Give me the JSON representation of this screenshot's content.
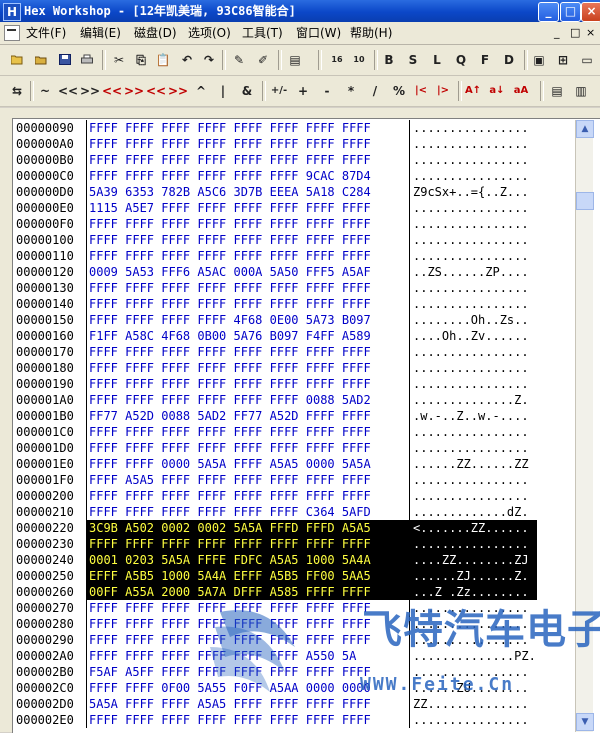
{
  "window": {
    "title": "Hex Workshop - [12年凯美瑞, 93C86智能合]",
    "minimize": "_",
    "maximize": "□",
    "close": "×"
  },
  "menu": {
    "items": [
      "文件(F)",
      "编辑(E)",
      "磁盘(D)",
      "选项(O)",
      "工具(T)",
      "窗口(W)",
      "帮助(H)"
    ],
    "mdi_min": "_",
    "mdi_max": "□",
    "mdi_close": "×"
  },
  "toolbar1": {
    "text_buttons": [
      "B",
      "S",
      "L",
      "Q",
      "F",
      "D"
    ],
    "mode_16": "16",
    "mode_10": "10"
  },
  "toolbar2": {
    "buttons": [
      "⇆",
      "~",
      "<<",
      ">>",
      "<<",
      ">>",
      "<<",
      ">>",
      "^",
      "|",
      "&",
      "+/-",
      "+",
      "-",
      "*",
      "/",
      "%",
      "|<",
      "|>",
      "A↑",
      "a↓",
      "aA"
    ]
  },
  "hex": {
    "rows": [
      {
        "addr": "00000090",
        "hex": "FFFF FFFF FFFF FFFF FFFF FFFF FFFF FFFF",
        "ascii": "................"
      },
      {
        "addr": "000000A0",
        "hex": "FFFF FFFF FFFF FFFF FFFF FFFF FFFF FFFF",
        "ascii": "................"
      },
      {
        "addr": "000000B0",
        "hex": "FFFF FFFF FFFF FFFF FFFF FFFF FFFF FFFF",
        "ascii": "................"
      },
      {
        "addr": "000000C0",
        "hex": "FFFF FFFF FFFF FFFF FFFF FFFF 9CAC 87D4",
        "ascii": "................"
      },
      {
        "addr": "000000D0",
        "hex": "5A39 6353 782B A5C6 3D7B EEEA 5A18 C284",
        "ascii": "Z9cSx+..={..Z..."
      },
      {
        "addr": "000000E0",
        "hex": "1115 A5E7 FFFF FFFF FFFF FFFF FFFF FFFF",
        "ascii": "................"
      },
      {
        "addr": "000000F0",
        "hex": "FFFF FFFF FFFF FFFF FFFF FFFF FFFF FFFF",
        "ascii": "................"
      },
      {
        "addr": "00000100",
        "hex": "FFFF FFFF FFFF FFFF FFFF FFFF FFFF FFFF",
        "ascii": "................"
      },
      {
        "addr": "00000110",
        "hex": "FFFF FFFF FFFF FFFF FFFF FFFF FFFF FFFF",
        "ascii": "................"
      },
      {
        "addr": "00000120",
        "hex": "0009 5A53 FFF6 A5AC 000A 5A50 FFF5 A5AF",
        "ascii": "..ZS......ZP...."
      },
      {
        "addr": "00000130",
        "hex": "FFFF FFFF FFFF FFFF FFFF FFFF FFFF FFFF",
        "ascii": "................"
      },
      {
        "addr": "00000140",
        "hex": "FFFF FFFF FFFF FFFF FFFF FFFF FFFF FFFF",
        "ascii": "................"
      },
      {
        "addr": "00000150",
        "hex": "FFFF FFFF FFFF FFFF 4F68 0E00 5A73 B097",
        "ascii": "........Oh..Zs.."
      },
      {
        "addr": "00000160",
        "hex": "F1FF A58C 4F68 0B00 5A76 B097 F4FF A589",
        "ascii": "....Oh..Zv......"
      },
      {
        "addr": "00000170",
        "hex": "FFFF FFFF FFFF FFFF FFFF FFFF FFFF FFFF",
        "ascii": "................"
      },
      {
        "addr": "00000180",
        "hex": "FFFF FFFF FFFF FFFF FFFF FFFF FFFF FFFF",
        "ascii": "................"
      },
      {
        "addr": "00000190",
        "hex": "FFFF FFFF FFFF FFFF FFFF FFFF FFFF FFFF",
        "ascii": "................"
      },
      {
        "addr": "000001A0",
        "hex": "FFFF FFFF FFFF FFFF FFFF FFFF 0088 5AD2",
        "ascii": "..............Z."
      },
      {
        "addr": "000001B0",
        "hex": "FF77 A52D 0088 5AD2 FF77 A52D FFFF FFFF",
        "ascii": ".w.-..Z..w.-...."
      },
      {
        "addr": "000001C0",
        "hex": "FFFF FFFF FFFF FFFF FFFF FFFF FFFF FFFF",
        "ascii": "................"
      },
      {
        "addr": "000001D0",
        "hex": "FFFF FFFF FFFF FFFF FFFF FFFF FFFF FFFF",
        "ascii": "................"
      },
      {
        "addr": "000001E0",
        "hex": "FFFF FFFF 0000 5A5A FFFF A5A5 0000 5A5A",
        "ascii": "......ZZ......ZZ"
      },
      {
        "addr": "000001F0",
        "hex": "FFFF A5A5 FFFF FFFF FFFF FFFF FFFF FFFF",
        "ascii": "................"
      },
      {
        "addr": "00000200",
        "hex": "FFFF FFFF FFFF FFFF FFFF FFFF FFFF FFFF",
        "ascii": "................"
      },
      {
        "addr": "00000210",
        "hex": "FFFF FFFF FFFF FFFF FFFF FFFF C364 5AFD",
        "ascii": ".............dZ."
      },
      {
        "addr": "00000220",
        "hex": "3C9B A502 0002 0002 5A5A FFFD FFFD A5A5",
        "ascii": "<.......ZZ......",
        "sel": true
      },
      {
        "addr": "00000230",
        "hex": "FFFF FFFF FFFF FFFF FFFF FFFF FFFF FFFF",
        "ascii": "................",
        "sel": true
      },
      {
        "addr": "00000240",
        "hex": "0001 0203 5A5A FFFE FDFC A5A5 1000 5A4A",
        "ascii": "....ZZ........ZJ",
        "sel": true
      },
      {
        "addr": "00000250",
        "hex": "EFFF A5B5 1000 5A4A EFFF A5B5 FF00 5AA5",
        "ascii": "......ZJ......Z.",
        "sel": true
      },
      {
        "addr": "00000260",
        "hex": "00FF A55A 2000 5A7A DFFF A585 FFFF FFFF",
        "ascii": "...Z .Zz........",
        "sel": true
      },
      {
        "addr": "00000270",
        "hex": "FFFF FFFF FFFF FFFF FFFF FFFF FFFF FFFF",
        "ascii": "................"
      },
      {
        "addr": "00000280",
        "hex": "FFFF FFFF FFFF FFFF FFFF FFFF FFFF FFFF",
        "ascii": "................"
      },
      {
        "addr": "00000290",
        "hex": "FFFF FFFF FFFF FFFF FFFF FFFF FFFF FFFF",
        "ascii": "................"
      },
      {
        "addr": "000002A0",
        "hex": "FFFF FFFF FFFF FFFF FFFF FFFF A550 5A",
        "ascii": "..............PZ."
      },
      {
        "addr": "000002B0",
        "hex": "F5AF A5FF FFFF FFFF FFFF FFFF FFFF FFFF",
        "ascii": "................"
      },
      {
        "addr": "000002C0",
        "hex": "FFFF FFFF 0F00 5A55 F0FF A5AA 0000 0000",
        "ascii": "......ZU........"
      },
      {
        "addr": "000002D0",
        "hex": "5A5A FFFF FFFF A5A5 FFFF FFFF FFFF FFFF",
        "ascii": "ZZ.............."
      },
      {
        "addr": "000002E0",
        "hex": "FFFF FFFF FFFF FFFF FFFF FFFF FFFF FFFF",
        "ascii": "................"
      }
    ]
  },
  "watermark": {
    "brand": "飞特汽车电子",
    "url": "WWW.Feite.Cn",
    "color": "#2864be"
  },
  "colors": {
    "hex_text": "#0000c8",
    "selection_bg": "#000000",
    "selection_hex": "#ffff40",
    "titlebar": "#0b47c8"
  }
}
